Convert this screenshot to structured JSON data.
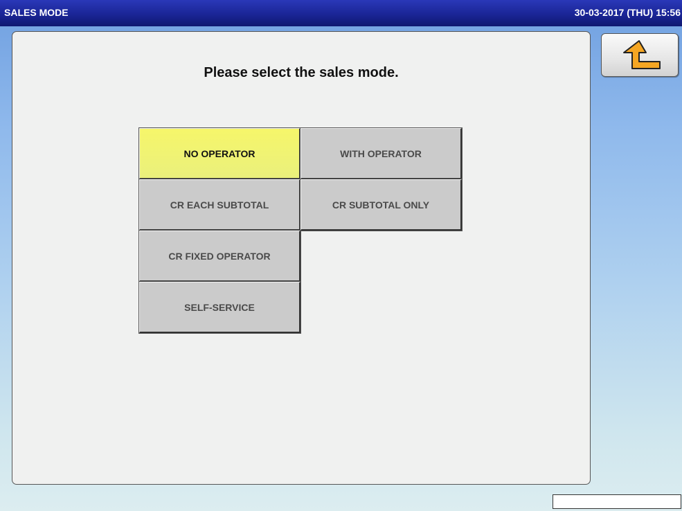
{
  "header": {
    "title": "SALES MODE",
    "datetime": "30-03-2017 (THU)  15:56"
  },
  "main": {
    "prompt": "Please select the sales mode.",
    "modes": [
      {
        "label": "NO OPERATOR",
        "selected": true
      },
      {
        "label": "WITH OPERATOR",
        "selected": false
      },
      {
        "label": "CR EACH SUBTOTAL",
        "selected": false
      },
      {
        "label": "CR SUBTOTAL ONLY",
        "selected": false
      },
      {
        "label": "CR FIXED OPERATOR",
        "selected": false
      },
      {
        "label": "SELF-SERVICE",
        "selected": false
      }
    ]
  },
  "back_button": {
    "icon": "return-arrow-icon"
  },
  "status_box": {
    "value": ""
  },
  "colors": {
    "titlebar": "#1a2596",
    "selected_button": "#f6f66a",
    "button": "#cbcbcb",
    "panel": "#f0f1f0",
    "back_arrow": "#f5a623"
  }
}
